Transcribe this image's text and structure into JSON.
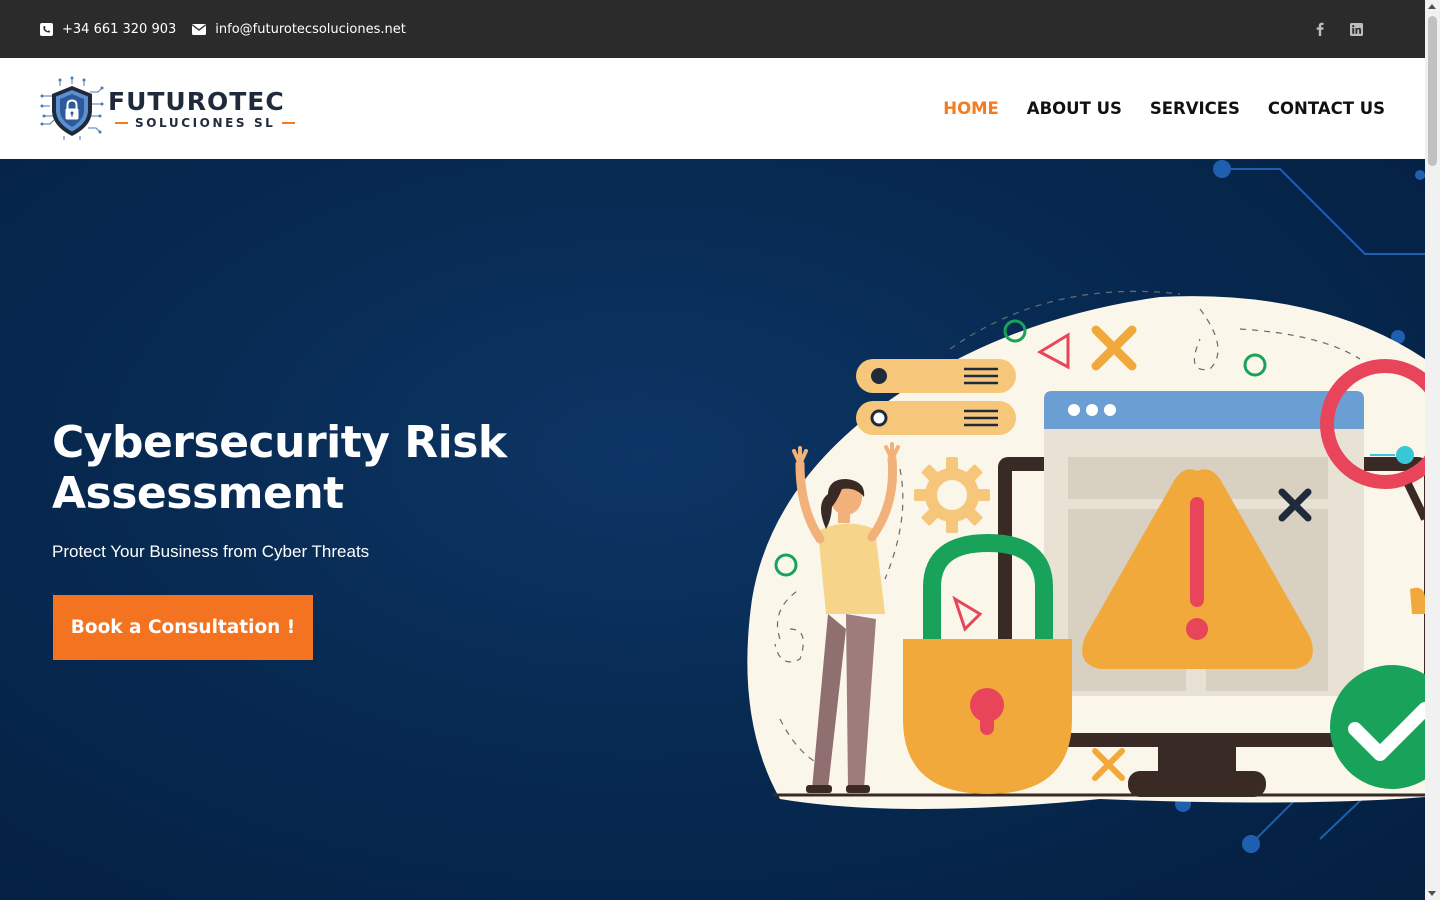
{
  "topbar": {
    "phone": "+34 661 320 903",
    "email": "info@futurotecsoluciones.net",
    "icons": [
      "phone-icon",
      "envelope-icon",
      "facebook-icon",
      "linkedin-icon"
    ]
  },
  "logo": {
    "name": "FUTUROTEC",
    "sub": "SOLUCIONES SL"
  },
  "nav": {
    "items": [
      {
        "label": "HOME",
        "active": true
      },
      {
        "label": "ABOUT US",
        "active": false
      },
      {
        "label": "SERVICES",
        "active": false
      },
      {
        "label": "CONTACT US",
        "active": false
      }
    ]
  },
  "hero": {
    "title": "Cybersecurity Risk Assessment",
    "subtitle": "Protect Your Business from Cyber Threats",
    "cta": "Book a Consultation !"
  },
  "colors": {
    "accent": "#f47320",
    "topbar": "#2b2b2b",
    "hero_bg": "#072a52",
    "text_dark": "#111111"
  }
}
